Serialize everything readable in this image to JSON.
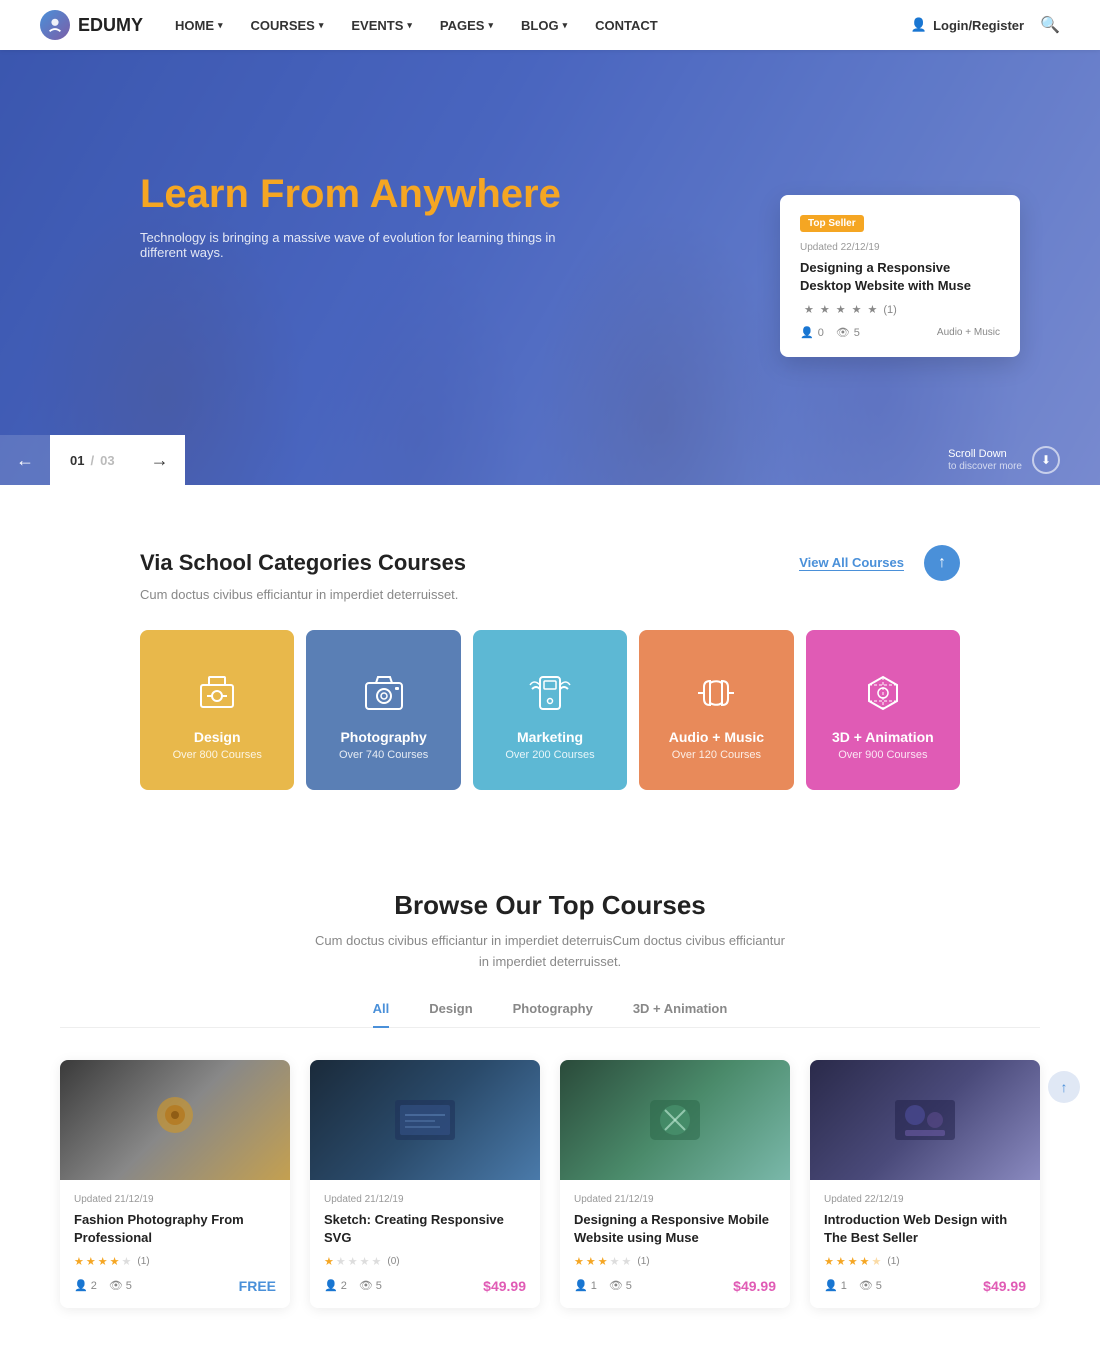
{
  "brand": {
    "name": "EDUMY"
  },
  "nav": {
    "items": [
      {
        "label": "HOME",
        "hasDropdown": true
      },
      {
        "label": "COURSES",
        "hasDropdown": true
      },
      {
        "label": "EVENTS",
        "hasDropdown": true
      },
      {
        "label": "PAGES",
        "hasDropdown": true
      },
      {
        "label": "BLOG",
        "hasDropdown": true
      },
      {
        "label": "CONTACT",
        "hasDropdown": false
      }
    ],
    "login_label": "Login/Register",
    "search_label": "Search"
  },
  "hero": {
    "title_prefix": "Learn From ",
    "title_highlight": "Anywhere",
    "subtitle": "Technology is bringing a massive wave of evolution for learning things in different ways.",
    "slider_current": "01",
    "slider_sep": "/",
    "slider_total": "03",
    "scroll_down": "Scroll Down",
    "scroll_sub": "to discover more"
  },
  "hero_card": {
    "badge": "Top Seller",
    "updated": "Updated 22/12/19",
    "title": "Designing a Responsive Desktop Website with Muse",
    "stars": 4,
    "review_count": "(1)",
    "students": "0",
    "lessons": "5",
    "category": "Audio + Music"
  },
  "categories_section": {
    "title": "Via School Categories Courses",
    "subtitle": "Cum doctus civibus efficiantur in imperdiet deterruisset.",
    "view_all": "View All Courses",
    "items": [
      {
        "name": "Design",
        "count": "Over 800 Courses",
        "color": "cat-design"
      },
      {
        "name": "Photography",
        "count": "Over 740 Courses",
        "color": "cat-photo"
      },
      {
        "name": "Marketing",
        "count": "Over 200 Courses",
        "color": "cat-marketing"
      },
      {
        "name": "Audio + Music",
        "count": "Over 120 Courses",
        "color": "cat-audio"
      },
      {
        "name": "3D + Animation",
        "count": "Over 900 Courses",
        "color": "cat-3d"
      }
    ]
  },
  "top_courses": {
    "title": "Browse Our Top Courses",
    "subtitle": "Cum doctus civibus efficiantur in imperdiet deterruisCum doctus civibus efficiantur in imperdiet deterruisset.",
    "tabs": [
      {
        "label": "All",
        "active": true
      },
      {
        "label": "Design",
        "active": false
      },
      {
        "label": "Photography",
        "active": false
      },
      {
        "label": "3D + Animation",
        "active": false
      }
    ],
    "courses": [
      {
        "updated": "Updated 21/12/19",
        "title": "Fashion Photography From Professional",
        "stars": 4,
        "half": false,
        "review_count": "(1)",
        "students": "2",
        "lessons": "5",
        "price": "FREE",
        "price_type": "free"
      },
      {
        "updated": "Updated 21/12/19",
        "title": "Sketch: Creating Responsive SVG",
        "stars": 1,
        "half": false,
        "review_count": "(0)",
        "students": "2",
        "lessons": "5",
        "price": "$49.99",
        "price_type": "paid"
      },
      {
        "updated": "Updated 21/12/19",
        "title": "Designing a Responsive Mobile Website using Muse",
        "stars": 3,
        "half": false,
        "review_count": "(1)",
        "students": "1",
        "lessons": "5",
        "price": "$49.99",
        "price_type": "paid"
      },
      {
        "updated": "Updated 22/12/19",
        "title": "Introduction Web Design with The Best Seller",
        "stars": 4,
        "half": true,
        "review_count": "(1)",
        "students": "1",
        "lessons": "5",
        "price": "$49.99",
        "price_type": "paid"
      }
    ]
  }
}
